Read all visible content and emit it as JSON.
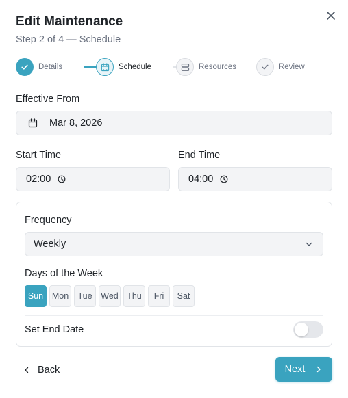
{
  "dialog": {
    "title": "Edit Maintenance",
    "subtitle": "Step 2 of 4 — Schedule"
  },
  "stepper": {
    "steps": [
      {
        "label": "Details",
        "state": "done",
        "icon": "check-icon"
      },
      {
        "label": "Schedule",
        "state": "current",
        "icon": "calendar-icon"
      },
      {
        "label": "Resources",
        "state": "todo",
        "icon": "server-icon"
      },
      {
        "label": "Review",
        "state": "todo",
        "icon": "check-icon"
      }
    ]
  },
  "form": {
    "effective_from": {
      "label": "Effective From",
      "value": "Mar 8, 2026",
      "icon": "calendar-icon"
    },
    "start_time": {
      "label": "Start Time",
      "value": "02:00",
      "icon": "clock-icon"
    },
    "end_time": {
      "label": "End Time",
      "value": "04:00",
      "icon": "clock-icon"
    },
    "frequency": {
      "label": "Frequency",
      "value": "Weekly",
      "icon": "chevron-down-icon"
    },
    "days": {
      "label": "Days of the Week",
      "items": [
        {
          "label": "Sun",
          "selected": true
        },
        {
          "label": "Mon",
          "selected": false
        },
        {
          "label": "Tue",
          "selected": false
        },
        {
          "label": "Wed",
          "selected": false
        },
        {
          "label": "Thu",
          "selected": false
        },
        {
          "label": "Fri",
          "selected": false
        },
        {
          "label": "Sat",
          "selected": false
        }
      ]
    },
    "end_date": {
      "label": "Set End Date",
      "enabled": false
    }
  },
  "footer": {
    "back_label": "Back",
    "next_label": "Next"
  },
  "colors": {
    "accent": "#3aa3bf",
    "field_bg": "#f3f4f6",
    "border": "#e1e4e8"
  }
}
